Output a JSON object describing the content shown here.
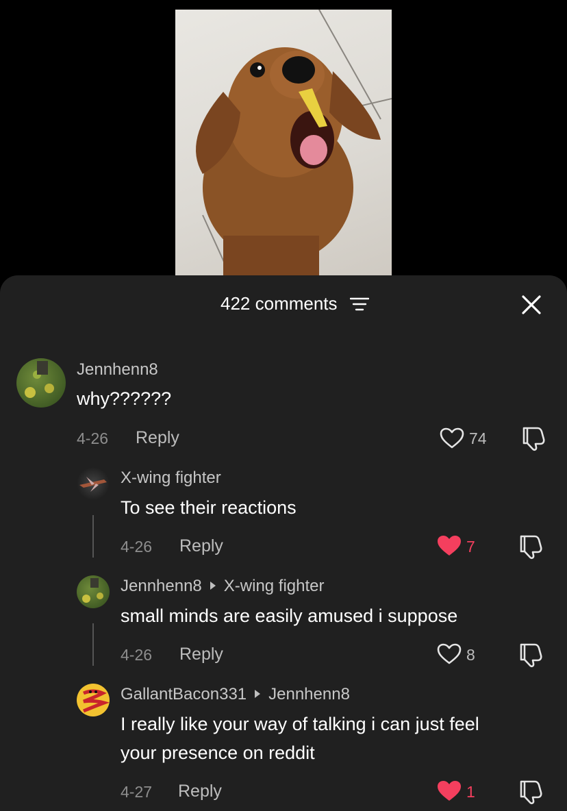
{
  "header": {
    "comments_label": "422 comments"
  },
  "comments": [
    {
      "username": "Jennhenn8",
      "text": "why??????",
      "date": "4-26",
      "reply_label": "Reply",
      "likes": "74",
      "liked": false
    },
    {
      "username": "X-wing fighter",
      "text": "To see their reactions",
      "date": "4-26",
      "reply_label": "Reply",
      "likes": "7",
      "liked": true
    },
    {
      "username": "Jennhenn8",
      "reply_to": "X-wing fighter",
      "text": "small minds are easily amused i suppose",
      "date": "4-26",
      "reply_label": "Reply",
      "likes": "8",
      "liked": false
    },
    {
      "username": "GallantBacon331",
      "reply_to": "Jennhenn8",
      "text_line1": "I really like your way of talking i can just feel",
      "text_line2": "your presence on reddit",
      "date": "4-27",
      "reply_label": "Reply",
      "likes": "1",
      "liked": true
    }
  ],
  "colors": {
    "like_active": "#f43f5e",
    "sheet_bg": "#202020"
  }
}
